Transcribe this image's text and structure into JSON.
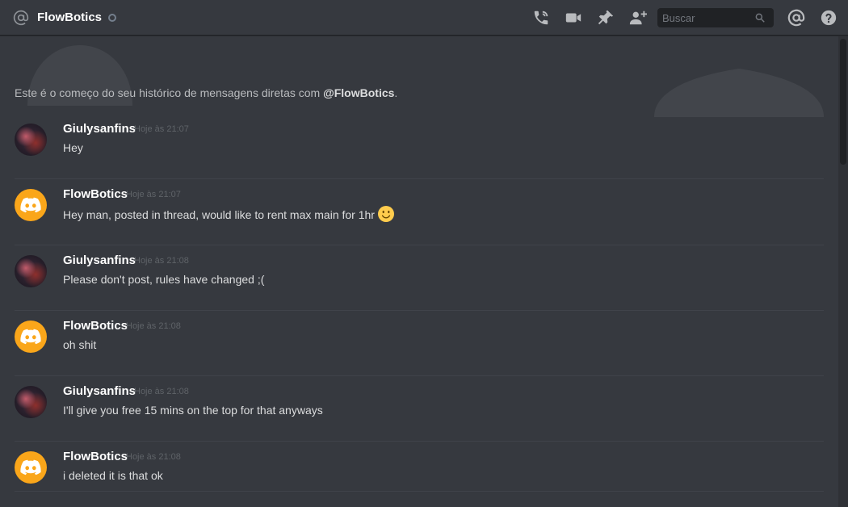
{
  "header": {
    "title": "FlowBotics",
    "search_placeholder": "Buscar",
    "tools": [
      "phone-call-icon",
      "video-icon",
      "pin-icon",
      "add-friend-icon",
      "mention-icon",
      "help-icon"
    ]
  },
  "intro": {
    "prefix": "Este é o começo do seu histórico de mensagens diretas com ",
    "handle": "@FlowBotics",
    "suffix": "."
  },
  "messages": [
    {
      "author": "Giulysanfins",
      "time": "Hoje às 21:07",
      "text": "Hey",
      "avatar": "user"
    },
    {
      "author": "FlowBotics",
      "time": "Hoje às 21:07",
      "text": "Hey man, posted in thread, would like to rent max main for 1hr",
      "avatar": "bot",
      "emoji": "slightly-smiling-face"
    },
    {
      "author": "Giulysanfins",
      "time": "Hoje às 21:08",
      "text": "Please don't post, rules have changed ;(",
      "avatar": "user"
    },
    {
      "author": "FlowBotics",
      "time": "Hoje às 21:08",
      "text": "oh shit",
      "avatar": "bot"
    },
    {
      "author": "Giulysanfins",
      "time": "Hoje às 21:08",
      "text": "I'll give you free 15 mins on the top for that anyways",
      "avatar": "user"
    },
    {
      "author": "FlowBotics",
      "time": "Hoje às 21:08",
      "text": "i deleted it is that ok",
      "avatar": "bot"
    }
  ],
  "colors": {
    "background": "#36393f",
    "bot_avatar": "#faa61a",
    "muted": "#72767d"
  }
}
